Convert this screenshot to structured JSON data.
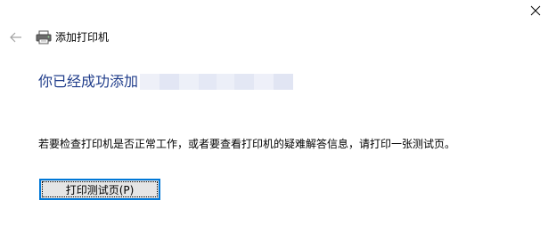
{
  "window": {
    "close_icon": "close-icon",
    "back_icon": "back-arrow-icon"
  },
  "header": {
    "icon": "printer-icon",
    "title": "添加打印机"
  },
  "main": {
    "heading": "你已经成功添加"
  },
  "description": "若要检查打印机是否正常工作，或者要查看打印机的疑难解答信息，请打印一张测试页。",
  "test_button": {
    "label": "打印测试页(P)"
  },
  "colors": {
    "heading": "#1f3c8a",
    "focus_border": "#0078d7",
    "button_bg": "#e5e5e5"
  }
}
